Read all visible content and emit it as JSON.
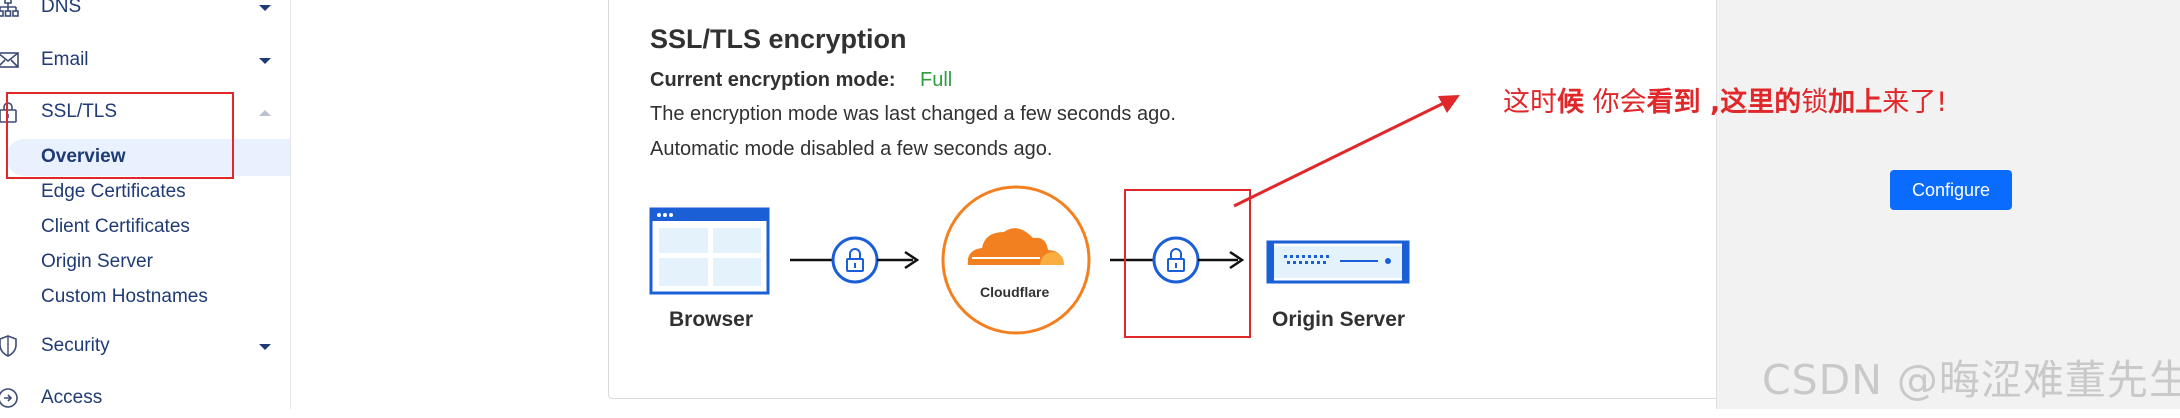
{
  "sidebar": {
    "items": [
      {
        "label": "DNS",
        "icon": "network-icon"
      },
      {
        "label": "Email",
        "icon": "envelope-icon"
      },
      {
        "label": "SSL/TLS",
        "icon": "lock-icon"
      },
      {
        "label": "Security",
        "icon": "shield-icon"
      },
      {
        "label": "Access",
        "icon": "access-icon"
      }
    ],
    "ssl_subitems": [
      "Overview",
      "Edge Certificates",
      "Client Certificates",
      "Origin Server",
      "Custom Hostnames"
    ]
  },
  "card": {
    "title": "SSL/TLS encryption",
    "mode_label": "Current encryption mode:",
    "mode_value": "Full",
    "line1": "The encryption mode was last changed a few seconds ago.",
    "line2": "Automatic mode disabled a few seconds ago."
  },
  "diagram": {
    "browser_label": "Browser",
    "cloud_label": "Cloudflare",
    "server_label": "Origin Server"
  },
  "right_panel": {
    "configure_label": "Configure"
  },
  "annotation": {
    "part1": "这时",
    "part2": "候",
    "part3": " 你会",
    "part4": "看到",
    "part5": " ,这",
    "part6": "里的",
    "part7": "锁",
    "part8": "加上",
    "part9": "来了!"
  },
  "watermark": "CSDN @晦涩难董先生",
  "colors": {
    "accent_blue": "#0a6cff",
    "diagram_blue": "#1a5fd6",
    "cloudflare_orange": "#f38020",
    "status_green": "#2e9e3e",
    "annotation_red": "#e0272a"
  }
}
